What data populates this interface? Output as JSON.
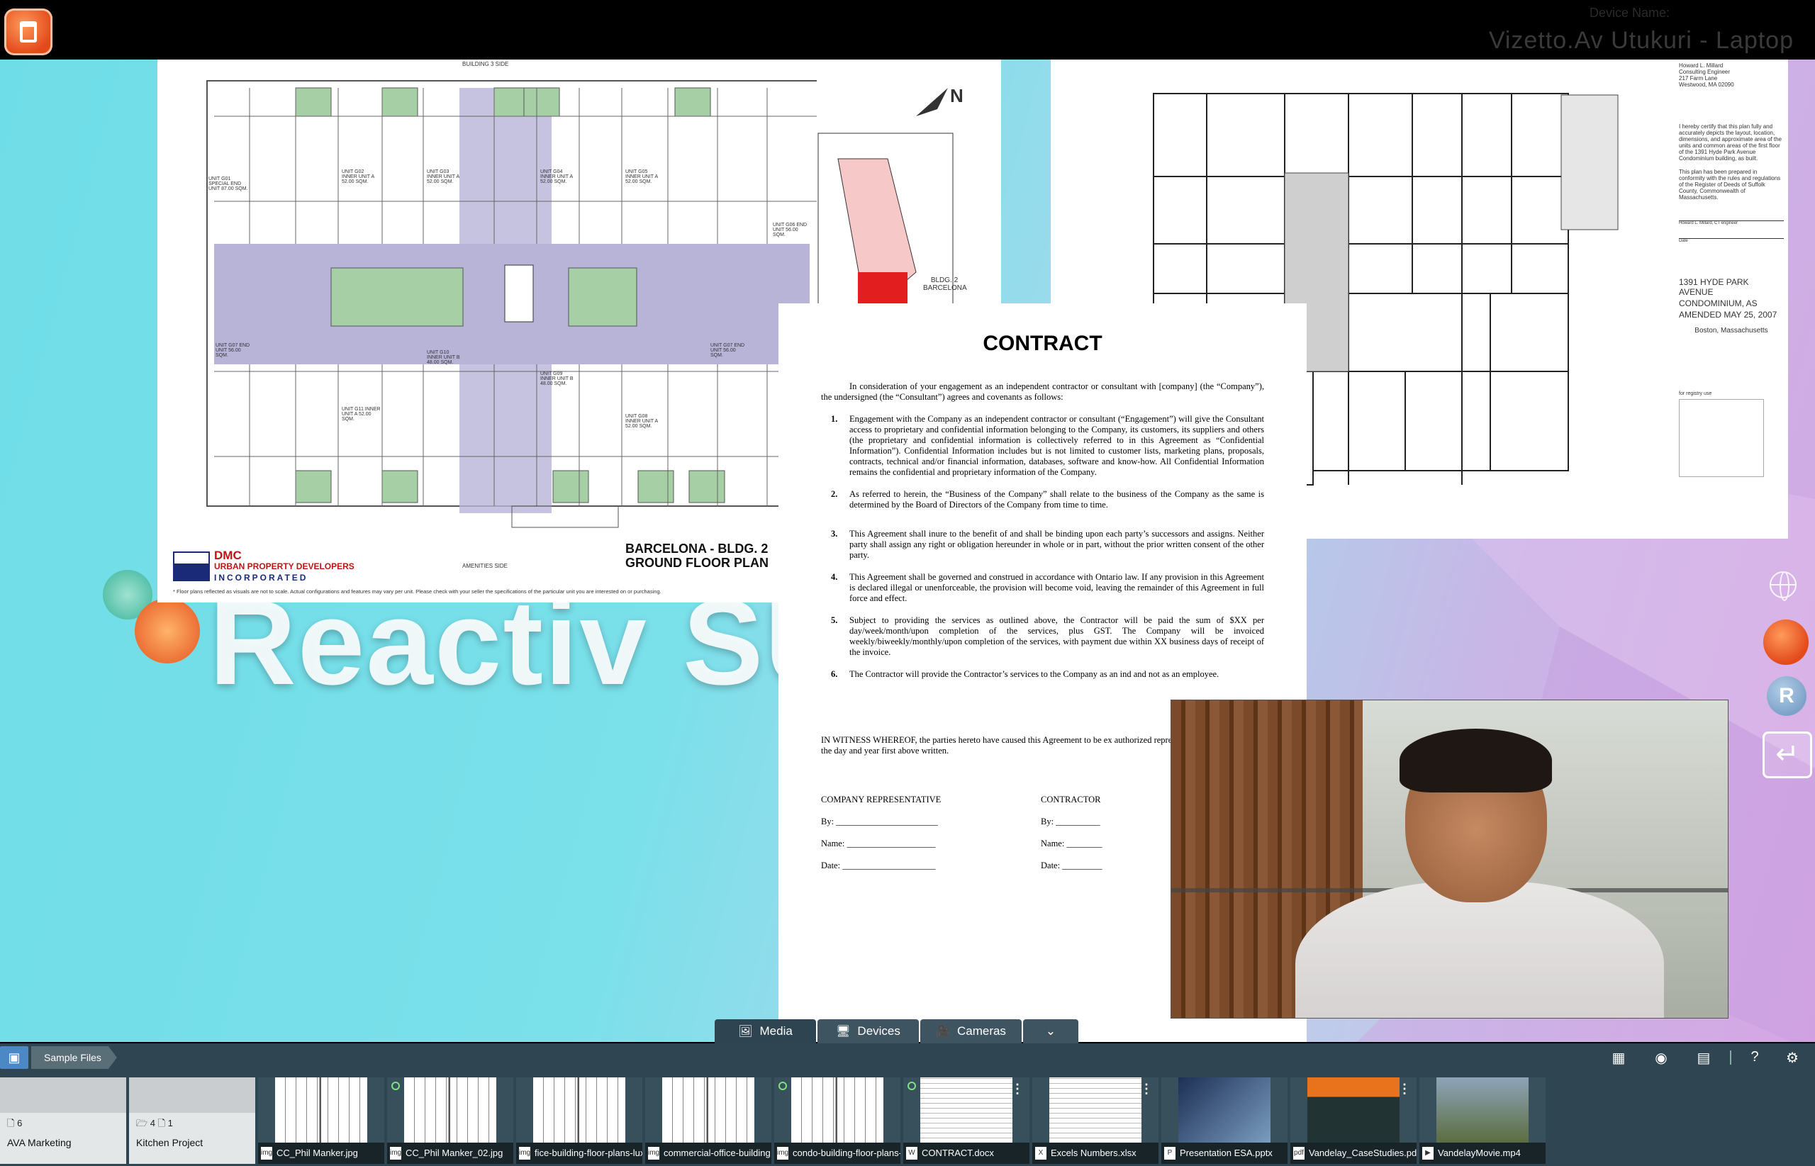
{
  "topbar": {
    "device_label": "Device Name:",
    "device_name": "Vizetto.Av Utukuri - Laptop"
  },
  "background": {
    "brand_text": "Reactiv SU"
  },
  "floorplan": {
    "top_label": "BUILDING 3 SIDE",
    "bottom_label": "AMENITIES SIDE",
    "title_line1": "BARCELONA - BLDG. 2",
    "title_line2": "GROUND FLOOR PLAN",
    "developer_line1": "DMC",
    "developer_line2": "URBAN PROPERTY DEVELOPERS",
    "developer_line3": "INCORPORATED",
    "disclaimer": "* Floor plans reflected as visuals are not to scale. Actual configurations and features may vary per unit. Please check with your seller the specifications of the particular unit you are interested on or purchasing.",
    "north_label": "N",
    "site_label": "BLDG. 2 BARCELONA",
    "units": [
      "UNIT G01 SPECIAL END UNIT 87.00 SQM.",
      "UNIT G02 INNER UNIT A 52.00 SQM.",
      "UNIT G03 INNER UNIT A 52.00 SQM.",
      "UNIT G04 INNER UNIT A 52.00 SQM.",
      "UNIT G05 INNER UNIT A 52.00 SQM.",
      "UNIT G06 END UNIT 56.00 SQM.",
      "UNIT G07 END UNIT 56.00 SQM.",
      "UNIT G10 INNER UNIT B 48.00 SQM.",
      "UNIT G11 INNER UNIT A 52.00 SQM.",
      "UNIT G09 INNER UNIT B 48.00 SQM.",
      "UNIT G08 INNER UNIT A 52.00 SQM.",
      "UNIT G07 END UNIT 56.00 SQM."
    ]
  },
  "floorplan2": {
    "engineer": "Howard L. Millard",
    "engineer_title": "Consulting Engineer",
    "street": "217 Farm Lane",
    "city": "Westwood, MA 02090",
    "certification": "I hereby certify that this plan fully and accurately depicts the layout, location, dimensions, and approximate area of the units and common areas of the first floor of the 1391 Hyde Park Avenue Condominium building, as built.",
    "conformity": "This plan has been prepared in conformity with the rules and regulations of the Register of Deeds of Suffolk County, Commonwealth of Massachusetts.",
    "signature": "Howard L. Millard, CT engineer",
    "date_label": "Date",
    "address_line1": "1391 HYDE PARK AVENUE",
    "address_line2": "CONDOMINIUM, AS",
    "address_line3": "AMENDED MAY 25, 2007",
    "location": "Boston, Massachusetts",
    "registry": "for registry use"
  },
  "contract": {
    "title": "CONTRACT",
    "intro": "In consideration of your engagement as an independent contractor or consultant with [company] (the “Company”), the undersigned (the “Consultant”) agrees and covenants as follows:",
    "clauses": [
      {
        "num": "1.",
        "text": "Engagement with the Company as an independent contractor or consultant (“Engagement”) will give the Consultant access to proprietary and confidential information belonging to the Company, its customers, its suppliers and others (the proprietary and confidential information is collectively referred to in this Agreement as “Confidential Information”). Confidential Information includes but is not limited to customer lists, marketing plans, proposals, contracts, technical and/or financial information, databases, software and know-how. All Confidential Information remains the confidential and proprietary information of the Company."
      },
      {
        "num": "2.",
        "text": "As referred to herein, the “Business of the Company” shall relate to the business of the Company as the same is determined by the Board of Directors of the Company from time to time."
      },
      {
        "num": "3.",
        "text": "This Agreement shall inure to the benefit of and shall be binding upon each party’s successors and assigns. Neither party shall assign any right or obligation hereunder in whole or in part, without the prior written consent of the other party."
      },
      {
        "num": "4.",
        "text": "This Agreement shall be governed and construed in accordance with Ontario law. If any provision in this Agreement is declared illegal or unenforceable, the provision will become void, leaving the remainder of this Agreement in full force and effect."
      },
      {
        "num": "5.",
        "text": "Subject to providing the services as outlined above, the Contractor will be paid the sum of $XX per day/week/month/upon completion of the services, plus GST. The Company will be invoiced weekly/biweekly/monthly/upon completion of the services, with payment due within XX business days of receipt of the invoice."
      },
      {
        "num": "6.",
        "text": "The Contractor will provide the Contractor’s services to the Company as an ind and not as an employee."
      }
    ],
    "witness": "IN WITNESS WHEREOF, the parties hereto have caused this Agreement to be ex authorized representatives, effective as of the day and year first above written.",
    "rep_heading": "COMPANY REPRESENTATIVE",
    "contractor_heading": "CONTRACTOR",
    "by_label": "By: _______________________",
    "name_label": "Name: ____________________",
    "date_label": "Date: _____________________",
    "by_label2": "By: __________",
    "name_label2": "Name: ________",
    "date_label2": "Date: _________"
  },
  "side": {
    "r_label": "R",
    "back_arrow": "↵"
  },
  "tabs": [
    {
      "label": "Media",
      "icon": "🖼"
    },
    {
      "label": "Devices",
      "icon": "🖥"
    },
    {
      "label": "Cameras",
      "icon": "🎥"
    }
  ],
  "tab_more": "⌄",
  "mediabar": {
    "breadcrumb": "Sample Files",
    "tools": {
      "grid": "▦",
      "camera": "◉",
      "window": "▤",
      "help": "?",
      "settings": "⚙"
    },
    "folders": [
      {
        "name": "AVA Marketing",
        "counts": "🗋 6"
      },
      {
        "name": "Kitchen Project",
        "counts": "🗁 4  🗋 1"
      }
    ],
    "files": [
      {
        "name": "CC_Phil Manker.jpg",
        "kind": "plan",
        "ftype": "img",
        "dot": false,
        "kebab": false
      },
      {
        "name": "CC_Phil Manker_02.jpg",
        "kind": "plan",
        "ftype": "img",
        "dot": true,
        "kebab": false
      },
      {
        "name": "fice-building-floor-plans-lux",
        "kind": "plan",
        "ftype": "img",
        "dot": false,
        "kebab": false
      },
      {
        "name": "commercial-office-building",
        "kind": "plan",
        "ftype": "img",
        "dot": false,
        "kebab": false
      },
      {
        "name": "condo-building-floor-plans-",
        "kind": "plan",
        "ftype": "img",
        "dot": true,
        "kebab": false
      },
      {
        "name": "CONTRACT.docx",
        "kind": "lines",
        "ftype": "W",
        "dot": true,
        "kebab": true
      },
      {
        "name": "Excels Numbers.xlsx",
        "kind": "lines",
        "ftype": "X",
        "dot": false,
        "kebab": true
      },
      {
        "name": "Presentation ESA.pptx",
        "kind": "dark",
        "ftype": "P",
        "dot": false,
        "kebab": false
      },
      {
        "name": "Vandelay_CaseStudies.pdf",
        "kind": "orange",
        "ftype": "pdf",
        "dot": false,
        "kebab": true
      },
      {
        "name": "VandelayMovie.mp4",
        "kind": "video",
        "ftype": "▶",
        "dot": false,
        "kebab": false
      }
    ]
  }
}
